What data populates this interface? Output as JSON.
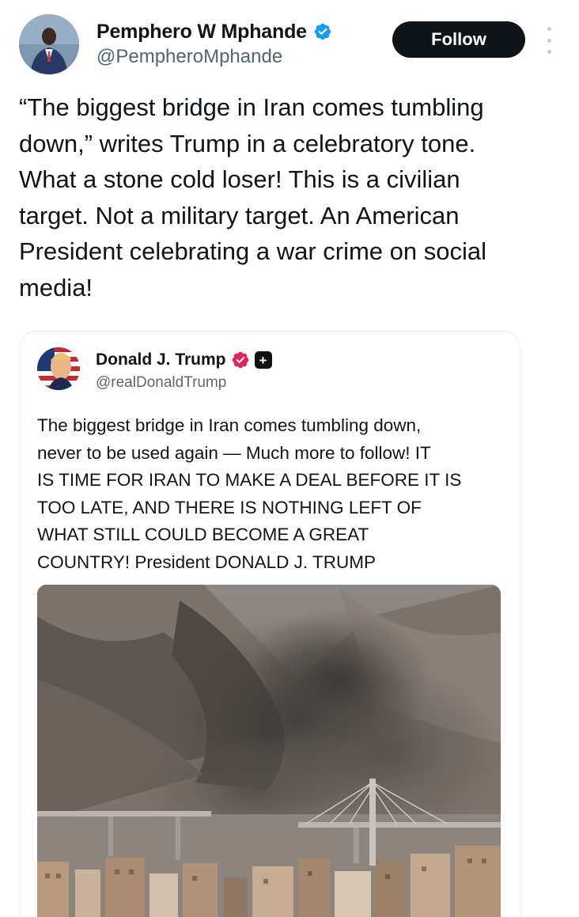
{
  "post": {
    "author": {
      "display_name": "Pemphero W Mphande",
      "handle": "@PempheroMphande",
      "verified_color": "#1d9bf0"
    },
    "follow_label": "Follow",
    "more_icon": "more-vertical-icon",
    "text_lines": [
      "“The biggest bridge in Iran comes tumbling",
      "down,” writes Trump in a celebratory tone.",
      "What a stone cold loser! This is a civilian",
      "target. Not a military target. An American",
      "President celebrating a war crime on social",
      "media!"
    ]
  },
  "embedded_post": {
    "author": {
      "display_name": "Donald J. Trump",
      "handle": "@realDonaldTrump",
      "verified_color": "#e0245e",
      "badge_icon": "plus-badge-icon",
      "badge_glyph": "+"
    },
    "text_lines": [
      "The biggest bridge in Iran comes tumbling down,",
      "never to be used again — Much more to follow! IT",
      "IS TIME FOR IRAN TO MAKE A DEAL BEFORE IT IS",
      "TOO LATE, AND THERE IS NOTHING LEFT OF",
      "WHAT STILL COULD BECOME A GREAT",
      "COUNTRY! President DONALD J. TRUMP"
    ],
    "media": {
      "type": "image",
      "subject": "smoke over a destroyed bridge in a mountain valley"
    }
  },
  "colors": {
    "text_primary": "#0f1419",
    "text_secondary": "#536471",
    "follow_button_bg": "#0f1419",
    "follow_button_text": "#ffffff"
  }
}
